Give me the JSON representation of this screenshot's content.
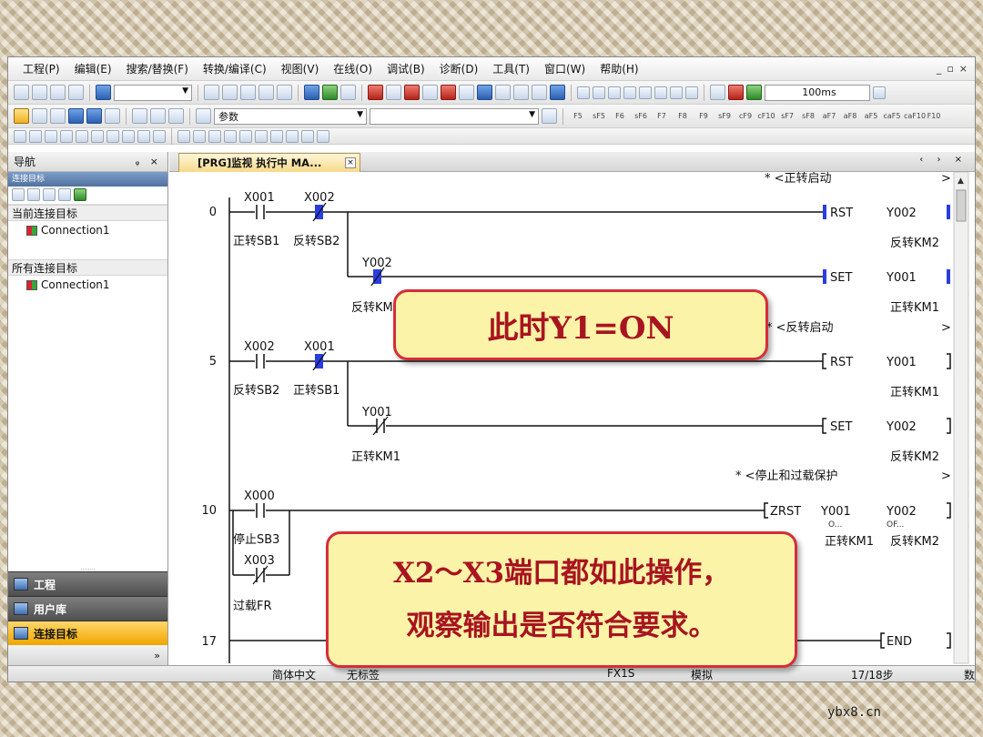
{
  "menu": [
    "工程(P)",
    "编辑(E)",
    "搜索/替换(F)",
    "转换/编译(C)",
    "视图(V)",
    "在线(O)",
    "调试(B)",
    "诊断(D)",
    "工具(T)",
    "窗口(W)",
    "帮助(H)"
  ],
  "window_controls": [
    "_",
    "▫",
    "×"
  ],
  "toolbar": {
    "scan_time": "100ms",
    "param_combo": "参数",
    "fkeys": [
      "F5",
      "sF5",
      "F6",
      "sF6",
      "F7",
      "F8",
      "F9",
      "sF9",
      "cF9",
      "cF10",
      "sF7",
      "sF8",
      "aF7",
      "aF8",
      "aF5",
      "caF5",
      "caF10",
      "F10"
    ]
  },
  "nav": {
    "title": "导航",
    "pins": "ᵩ ×",
    "subheader": "连接目标",
    "section_current": "当前连接目标",
    "conn_current": "Connection1",
    "section_all": "所有连接目标",
    "conn_all": "Connection1",
    "tabs": [
      "工程",
      "用户库",
      "连接目标"
    ],
    "grip": "........",
    "footer_icon": "»"
  },
  "editor": {
    "tab_label": "[PRG]监视 执行中 MA...",
    "tab_close": "×",
    "tab_nav": "‹ › ×"
  },
  "ladder": {
    "scroll_marks": [
      ">",
      ">",
      ">"
    ],
    "comments": [
      "* <正转启动",
      "* <反转启动",
      "* <停止和过载保护"
    ],
    "steps": [
      "0",
      "5",
      "10",
      "17"
    ],
    "rung0": {
      "c1": "X001",
      "c1c": "正转SB1",
      "c2": "X002",
      "c2c": "反转SB2",
      "coil1_inst": "RST",
      "coil1_dev": "Y002",
      "coil1_cmt": "反转KM2",
      "b": "Y002",
      "bc": "反转KM",
      "coil2_inst": "SET",
      "coil2_dev": "Y001",
      "coil2_cmt": "正转KM1"
    },
    "rung5": {
      "c1": "X002",
      "c1c": "反转SB2",
      "c2": "X001",
      "c2c": "正转SB1",
      "coil1_inst": "RST",
      "coil1_dev": "Y001",
      "coil1_cmt": "正转KM1",
      "b": "Y001",
      "bc": "正转KM1",
      "coil2_inst": "SET",
      "coil2_dev": "Y002",
      "coil2_cmt": "反转KM2"
    },
    "rung10": {
      "c1": "X000",
      "c1c": "停止SB3",
      "b": "X003",
      "bc": "过载FR",
      "inst": "ZRST",
      "op1": "Y001",
      "op1s": "O...",
      "op1c": "正转KM1",
      "op2": "Y002",
      "op2s": "OF...",
      "op2c": "反转KM2"
    },
    "rung17": {
      "inst": "END"
    }
  },
  "status": {
    "lang": "简体中文",
    "label": "无标签",
    "cpu": "FX1S",
    "mode": "模拟",
    "step": "17/18步",
    "extra": "数"
  },
  "callouts": {
    "c1": "此时Y1=ON",
    "c2_line1": "X2～X3端口都如此操作，",
    "c2_line2": "观察输出是否符合要求。"
  },
  "watermark": "ybx8.cn",
  "colors": {
    "energized": "#2a3de0",
    "callout_border": "#d62d3a",
    "callout_text": "#a81420",
    "callout_fill": "#fbf3a8"
  }
}
